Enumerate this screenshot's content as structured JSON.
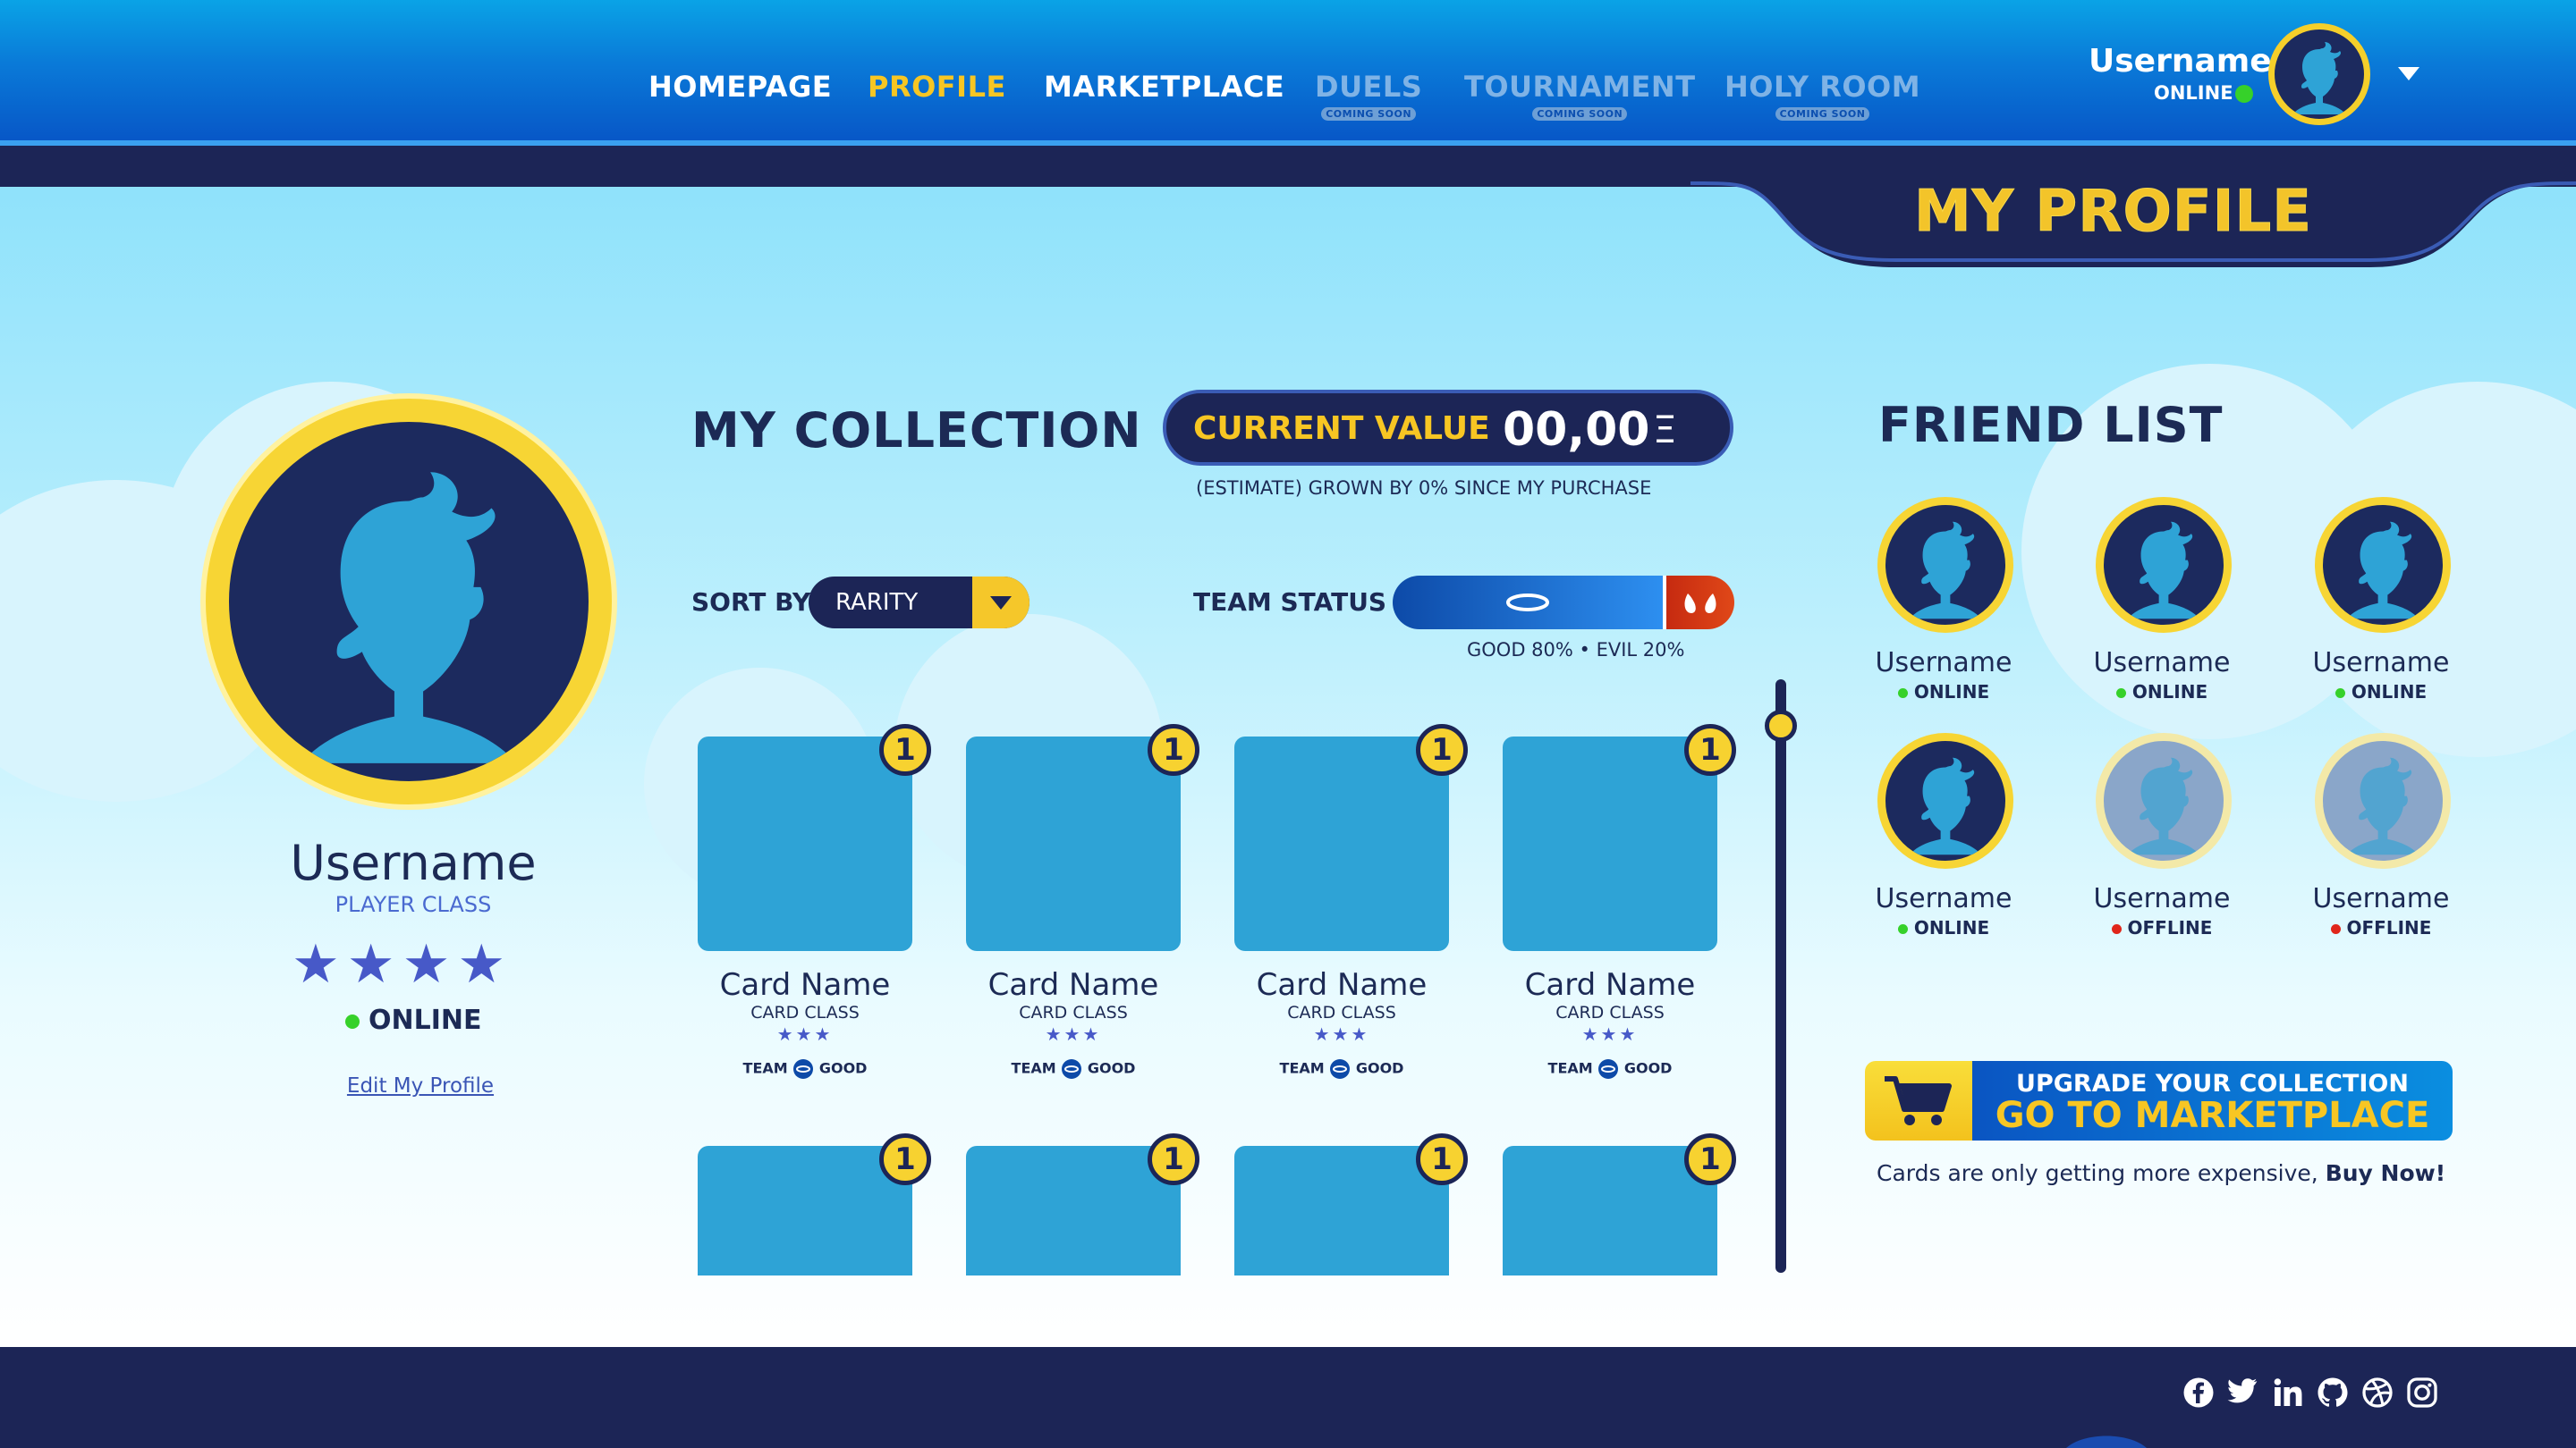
{
  "nav": {
    "items": [
      {
        "label": "HOMEPAGE",
        "state": "normal"
      },
      {
        "label": "PROFILE",
        "state": "active"
      },
      {
        "label": "MARKETPLACE",
        "state": "normal"
      },
      {
        "label": "DUELS",
        "state": "disabled",
        "badge": "COMING SOON"
      },
      {
        "label": "TOURNAMENT",
        "state": "disabled",
        "badge": "COMING SOON"
      },
      {
        "label": "HOLY ROOM",
        "state": "disabled",
        "badge": "COMING SOON"
      }
    ]
  },
  "header_user": {
    "name": "Username",
    "status": "ONLINE",
    "dropdown_icon": "chevron-down-icon"
  },
  "page_title": "MY PROFILE",
  "profile": {
    "name": "Username",
    "class": "PLAYER CLASS",
    "stars": 4,
    "status": "ONLINE",
    "edit_link": "Edit My Profile"
  },
  "collection": {
    "title": "MY COLLECTION",
    "current_value_label": "CURRENT VALUE",
    "current_value": "00,00",
    "currency_symbol": "Ξ",
    "estimate_note": "(ESTIMATE) GROWN BY 0% SINCE MY PURCHASE",
    "sort_label": "SORT BY",
    "sort_value": "RARITY",
    "team_status_label": "TEAM STATUS",
    "team_good_percent": 80,
    "team_evil_percent": 20,
    "team_status_caption": "GOOD 80% • EVIL 20%",
    "cards": [
      {
        "name": "Card Name",
        "class": "CARD CLASS",
        "stars": 3,
        "team_label": "TEAM",
        "team": "GOOD",
        "count": "1"
      },
      {
        "name": "Card Name",
        "class": "CARD CLASS",
        "stars": 3,
        "team_label": "TEAM",
        "team": "GOOD",
        "count": "1"
      },
      {
        "name": "Card Name",
        "class": "CARD CLASS",
        "stars": 3,
        "team_label": "TEAM",
        "team": "GOOD",
        "count": "1"
      },
      {
        "name": "Card Name",
        "class": "CARD CLASS",
        "stars": 3,
        "team_label": "TEAM",
        "team": "GOOD",
        "count": "1"
      }
    ],
    "cards_row2": [
      {
        "count": "1"
      },
      {
        "count": "1"
      },
      {
        "count": "1"
      },
      {
        "count": "1"
      }
    ]
  },
  "friends": {
    "title": "FRIEND LIST",
    "list": [
      {
        "name": "Username",
        "status": "ONLINE"
      },
      {
        "name": "Username",
        "status": "ONLINE"
      },
      {
        "name": "Username",
        "status": "ONLINE"
      },
      {
        "name": "Username",
        "status": "ONLINE"
      },
      {
        "name": "Username",
        "status": "OFFLINE"
      },
      {
        "name": "Username",
        "status": "OFFLINE"
      }
    ]
  },
  "cta": {
    "line1": "UPGRADE YOUR COLLECTION",
    "line2": "GO TO MARKETPLACE",
    "note_prefix": "Cards are only getting more expensive, ",
    "note_bold": "Buy Now!"
  },
  "social": [
    "facebook-icon",
    "twitter-icon",
    "linkedin-icon",
    "github-icon",
    "dribbble-icon",
    "instagram-icon"
  ],
  "colors": {
    "accent_yellow": "#f7c623",
    "navy": "#1c2556",
    "online": "#36d12a",
    "offline": "#e0261b",
    "card_blue": "#2ea3d6"
  }
}
